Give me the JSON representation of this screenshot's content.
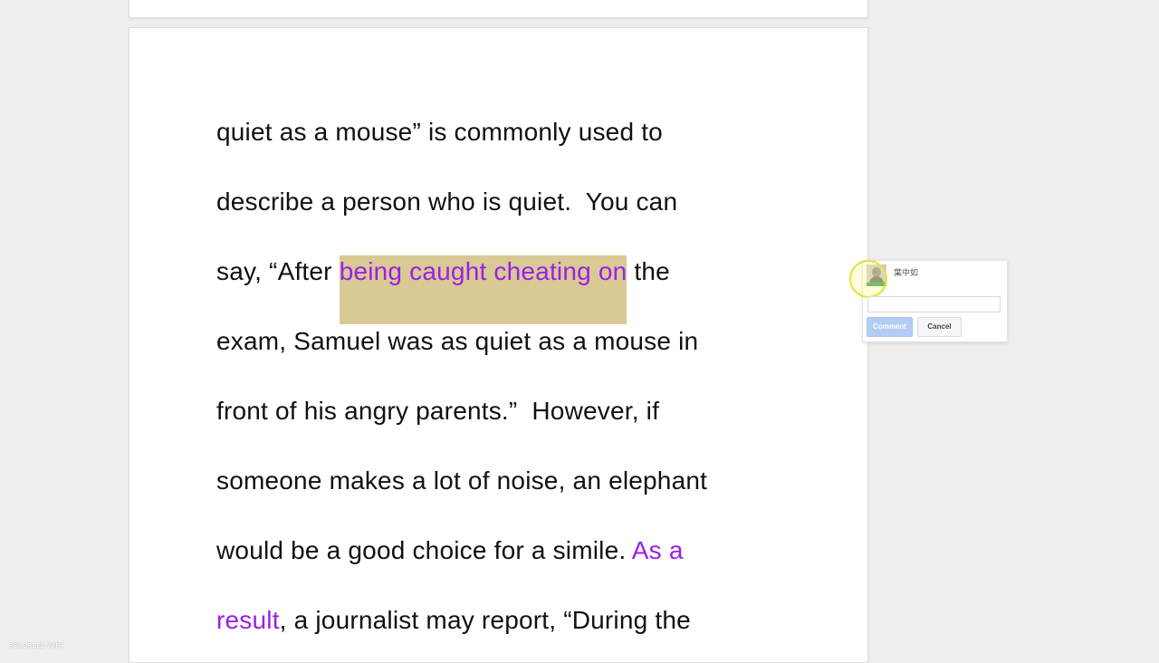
{
  "document": {
    "lines": [
      {
        "text": "quiet as a mouse” is commonly used to"
      },
      {
        "text": "describe a person who is quiet.  You can"
      },
      {
        "before": "say, “After ",
        "highlight": "being caught cheating on",
        "after": " the"
      },
      {
        "text": "exam, Samuel was as quiet as a mouse in"
      },
      {
        "text": "front of his angry parents.”  However, if"
      },
      {
        "text": "someone makes a lot of noise, an elephant"
      },
      {
        "before": "would be a good choice for a simile. ",
        "purple": "As a"
      },
      {
        "purple": "result",
        "after": ", a journalist may report, “During the"
      }
    ]
  },
  "comment": {
    "user_name": "葉中如",
    "input_value": "",
    "comment_label": "Comment",
    "cancel_label": "Cancel"
  },
  "watermark": "RECORDED WITH",
  "colors": {
    "highlight_bg": "#d9c994",
    "purple_text": "#9b1ee8",
    "comment_button": "#b3ccf5"
  }
}
